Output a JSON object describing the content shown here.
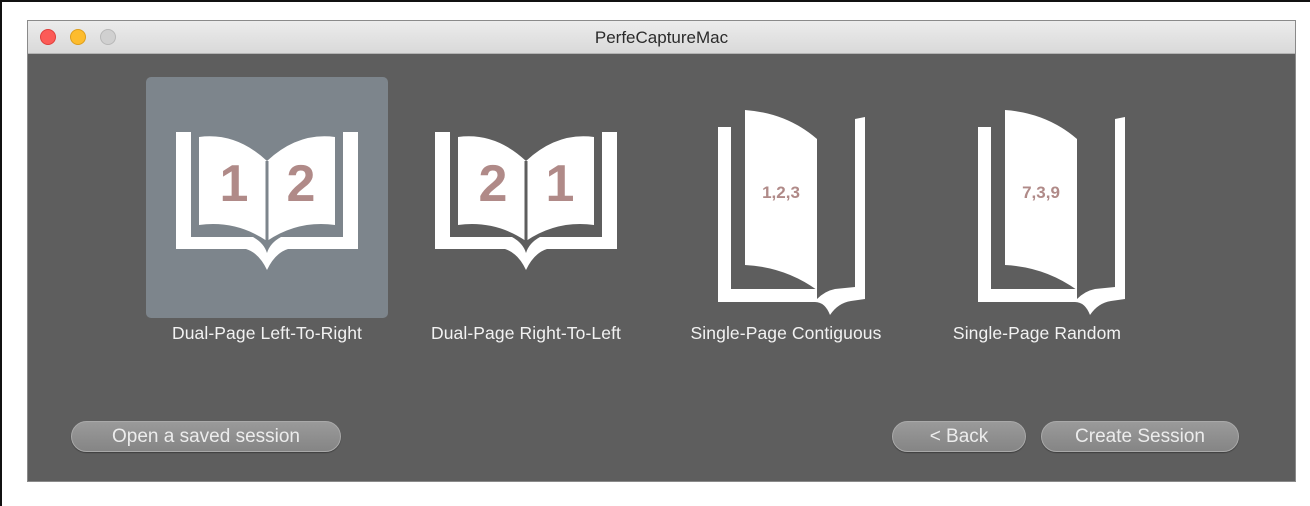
{
  "window": {
    "title": "PerfeCaptureMac"
  },
  "options": [
    {
      "label": "Dual-Page Left-To-Right",
      "page_left": "1",
      "page_right": "2",
      "selected": true
    },
    {
      "label": "Dual-Page Right-To-Left",
      "page_left": "2",
      "page_right": "1",
      "selected": false
    },
    {
      "label": "Single-Page Contiguous",
      "page_text": "1,2,3",
      "selected": false
    },
    {
      "label": "Single-Page Random",
      "page_text": "7,3,9",
      "selected": false
    }
  ],
  "buttons": {
    "open_session": "Open a saved session",
    "back": "< Back",
    "create_session": "Create Session"
  },
  "colors": {
    "window_bg": "#5e5e5e",
    "selected_bg": "#7d858c",
    "page_number": "#b08a88",
    "icon_white": "#ffffff"
  },
  "icons": [
    "book-open-icon",
    "book-open-icon",
    "book-single-page-icon",
    "book-single-page-icon"
  ]
}
